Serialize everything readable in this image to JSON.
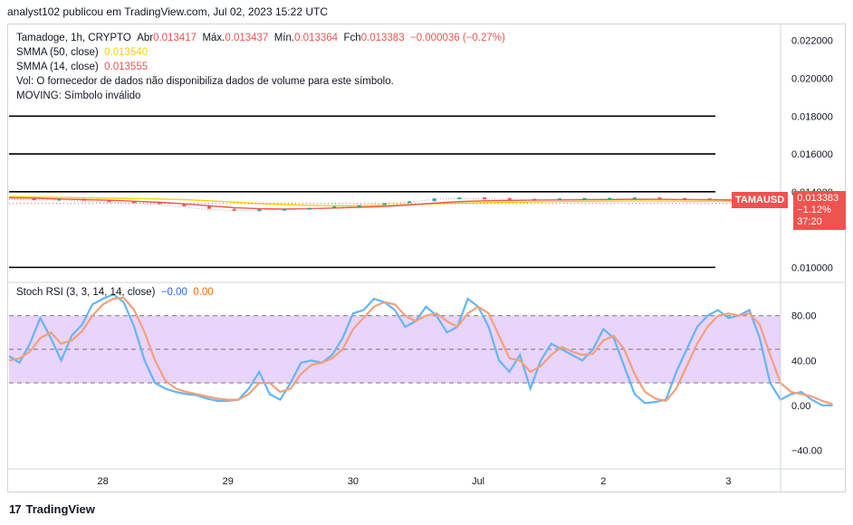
{
  "credit": "analyst102 publicou em TradingView.com, Jul 02, 2023 15:22 UTC",
  "legend": {
    "symbol_line": "Tamadoge, 1h, CRYPTO",
    "open_label": "Abr",
    "open": "0.013417",
    "high_label": "Máx.",
    "high": "0.013437",
    "low_label": "Mín.",
    "low": "0.013364",
    "close_label": "Fch",
    "close": "0.013383",
    "change": "−0.000036 (−0.27%)",
    "sma50_label": "SMMA (50, close)",
    "sma50": "0.013540",
    "sma14_label": "SMMA (14, close)",
    "sma14": "0.013555",
    "vol_note": "Vol: O fornecedor de dados não disponibiliza dados de volume para este símbolo.",
    "moving_note": "MOVING: Símbolo inválido",
    "rsi_label": "Stoch RSI (3, 3, 14, 14, close)",
    "rsi_k": "−0.00",
    "rsi_d": "0.00"
  },
  "badge": {
    "symbol": "TAMAUSD",
    "price": "0.013383",
    "change_pct": "−1.12%",
    "countdown": "37:20"
  },
  "footer": {
    "brand": "TradingView"
  },
  "colors": {
    "down": "#ef5350",
    "up": "#26a69a",
    "sma50": "#f5d300",
    "sma14": "#ef5350",
    "k": "#64b5f6",
    "d": "#f4a07a",
    "band": "#e9d4fb"
  },
  "chart_data": [
    {
      "type": "line",
      "title": "Tamadoge, 1h, CRYPTO",
      "y_ticks": [
        "0.022000",
        "0.020000",
        "0.018000",
        "0.016000",
        "0.014000",
        "0.010000"
      ],
      "ylim": [
        0.0093,
        0.0228
      ],
      "x_ticks": [
        "28",
        "29",
        "30",
        "Jul",
        "2",
        "3"
      ],
      "x_tick_positions": [
        8,
        32,
        56,
        80,
        104,
        128
      ],
      "xlim": [
        -10,
        138
      ],
      "horizontal_levels": [
        0.018,
        0.016,
        0.014,
        0.01
      ],
      "series": [
        {
          "name": "SMMA (50, close)",
          "values": [
            0.01375,
            0.01372,
            0.0137,
            0.01368,
            0.01366,
            0.01364,
            0.01362,
            0.01358,
            0.01352,
            0.01345,
            0.01338,
            0.01332,
            0.01328,
            0.01326,
            0.01326,
            0.01328,
            0.01332,
            0.01336,
            0.0134,
            0.01342,
            0.01344,
            0.01346,
            0.01348,
            0.01349,
            0.0135,
            0.01351,
            0.01351,
            0.0135,
            0.0135,
            0.01349,
            0.01348
          ]
        },
        {
          "name": "SMMA (14, close)",
          "values": [
            0.01368,
            0.01366,
            0.01362,
            0.01358,
            0.01355,
            0.0135,
            0.01344,
            0.01336,
            0.01326,
            0.01316,
            0.0131,
            0.01308,
            0.0131,
            0.01314,
            0.01318,
            0.01322,
            0.0133,
            0.0134,
            0.01348,
            0.01352,
            0.01354,
            0.01356,
            0.01357,
            0.01358,
            0.01359,
            0.0136,
            0.0136,
            0.01359,
            0.01358,
            0.01356,
            0.01353
          ]
        },
        {
          "name": "Price",
          "values": [
            0.0136,
            0.01356,
            0.01358,
            0.0135,
            0.01345,
            0.0134,
            0.0133,
            0.01318,
            0.01305,
            0.013,
            0.01302,
            0.01305,
            0.0131,
            0.01318,
            0.01325,
            0.01335,
            0.01345,
            0.0136,
            0.01365,
            0.01362,
            0.01358,
            0.01355,
            0.0136,
            0.01362,
            0.01363,
            0.01365,
            0.01362,
            0.0136,
            0.01356,
            0.0135,
            0.01338
          ]
        }
      ],
      "series_x_start": -10,
      "series_x_step": 4.8
    },
    {
      "type": "line",
      "title": "Stoch RSI (3, 3, 14, 14, close)",
      "y_ticks": [
        "80.00",
        "40.00",
        "0.00",
        "−40.00"
      ],
      "ylim": [
        -55,
        108
      ],
      "band": [
        20,
        80
      ],
      "midline": 50,
      "series_x_start": -10,
      "series_x_step": 2,
      "series": [
        {
          "name": "K",
          "values": [
            44,
            38,
            55,
            78,
            60,
            40,
            62,
            72,
            90,
            95,
            99,
            92,
            70,
            40,
            20,
            15,
            12,
            10,
            9,
            6,
            4,
            4,
            5,
            15,
            30,
            10,
            5,
            20,
            38,
            40,
            38,
            45,
            60,
            82,
            85,
            95,
            92,
            85,
            70,
            75,
            88,
            80,
            65,
            70,
            95,
            88,
            70,
            40,
            30,
            45,
            15,
            40,
            55,
            50,
            45,
            40,
            50,
            68,
            60,
            35,
            10,
            2,
            3,
            5,
            30,
            50,
            70,
            80,
            85,
            78,
            80,
            85,
            60,
            20,
            5,
            10,
            12,
            5,
            0,
            0
          ]
        },
        {
          "name": "D",
          "values": [
            40,
            42,
            48,
            60,
            65,
            55,
            58,
            66,
            80,
            90,
            95,
            96,
            85,
            65,
            40,
            22,
            15,
            12,
            10,
            8,
            6,
            5,
            5,
            10,
            20,
            20,
            12,
            15,
            28,
            36,
            38,
            42,
            50,
            68,
            78,
            88,
            92,
            90,
            80,
            75,
            80,
            82,
            75,
            70,
            82,
            88,
            82,
            62,
            42,
            40,
            30,
            35,
            45,
            52,
            48,
            45,
            46,
            58,
            62,
            50,
            28,
            12,
            6,
            4,
            15,
            35,
            55,
            70,
            80,
            82,
            80,
            82,
            72,
            45,
            20,
            12,
            10,
            8,
            4,
            1
          ]
        }
      ]
    }
  ]
}
